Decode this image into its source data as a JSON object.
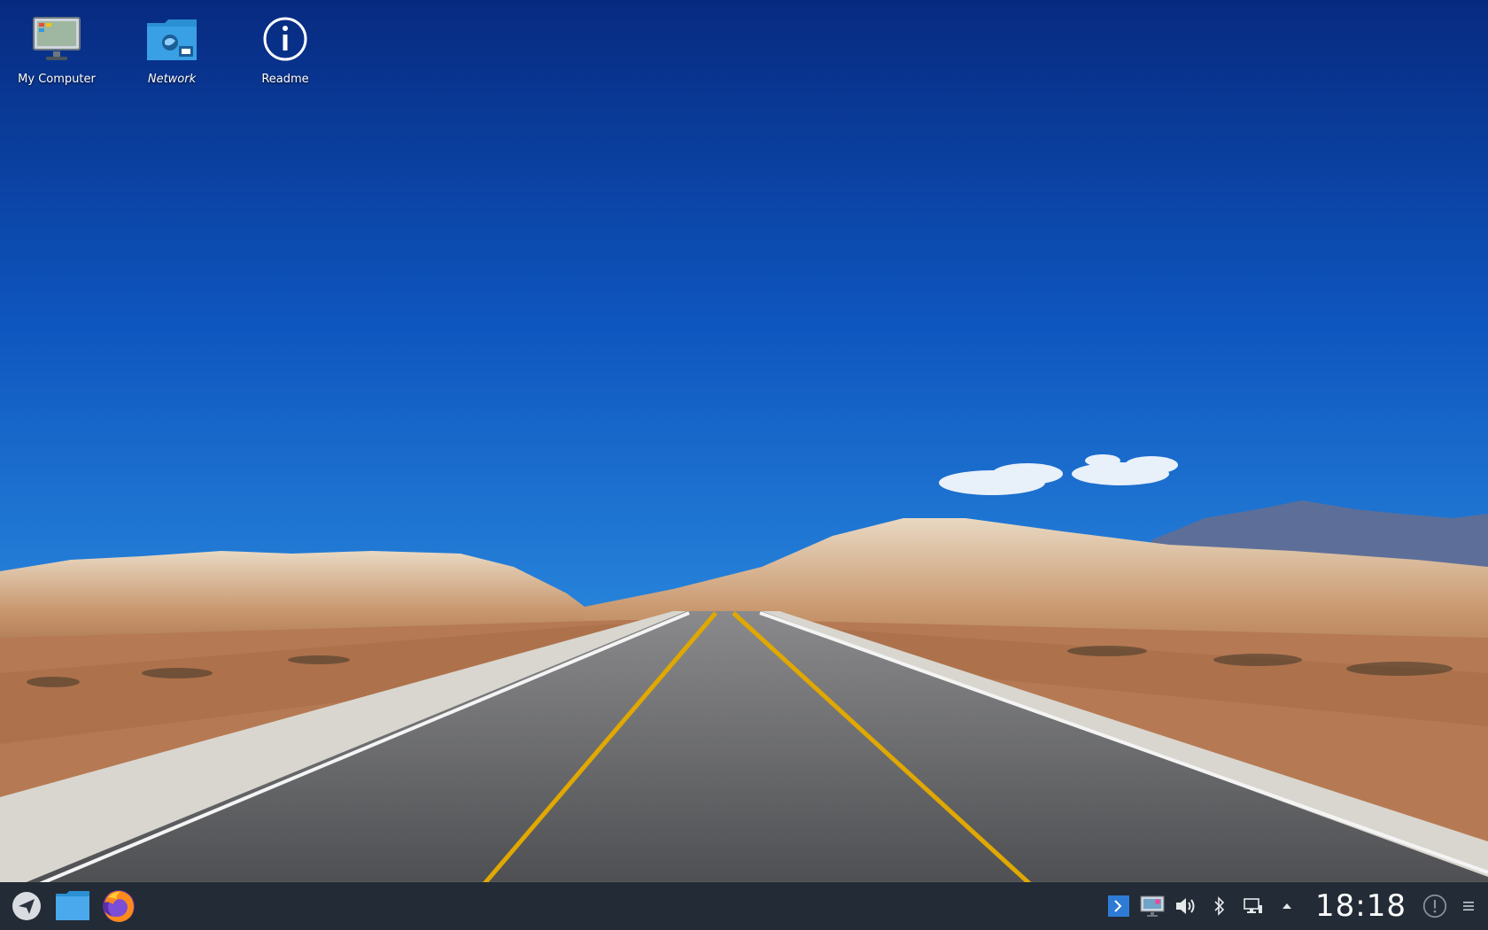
{
  "desktop": {
    "icons": [
      {
        "label": "My Computer",
        "icon": "computer-icon"
      },
      {
        "label": "Network",
        "icon": "network-folder-icon"
      },
      {
        "label": "Readme",
        "icon": "info-icon"
      }
    ]
  },
  "taskbar": {
    "launchers": [
      {
        "icon": "app-launcher-icon"
      },
      {
        "icon": "file-manager-icon"
      },
      {
        "icon": "firefox-icon"
      }
    ],
    "tray": [
      {
        "icon": "terminal-icon"
      },
      {
        "icon": "display-settings-icon"
      },
      {
        "icon": "volume-icon"
      },
      {
        "icon": "bluetooth-icon"
      },
      {
        "icon": "network-icon"
      },
      {
        "icon": "expand-tray-icon"
      }
    ],
    "clock": "18:18"
  },
  "colors": {
    "taskbar_bg": "#232b36",
    "sky_top": "#0a2d86",
    "sky_bottom": "#2f8fe0",
    "folder_blue": "#3aa0e6"
  }
}
